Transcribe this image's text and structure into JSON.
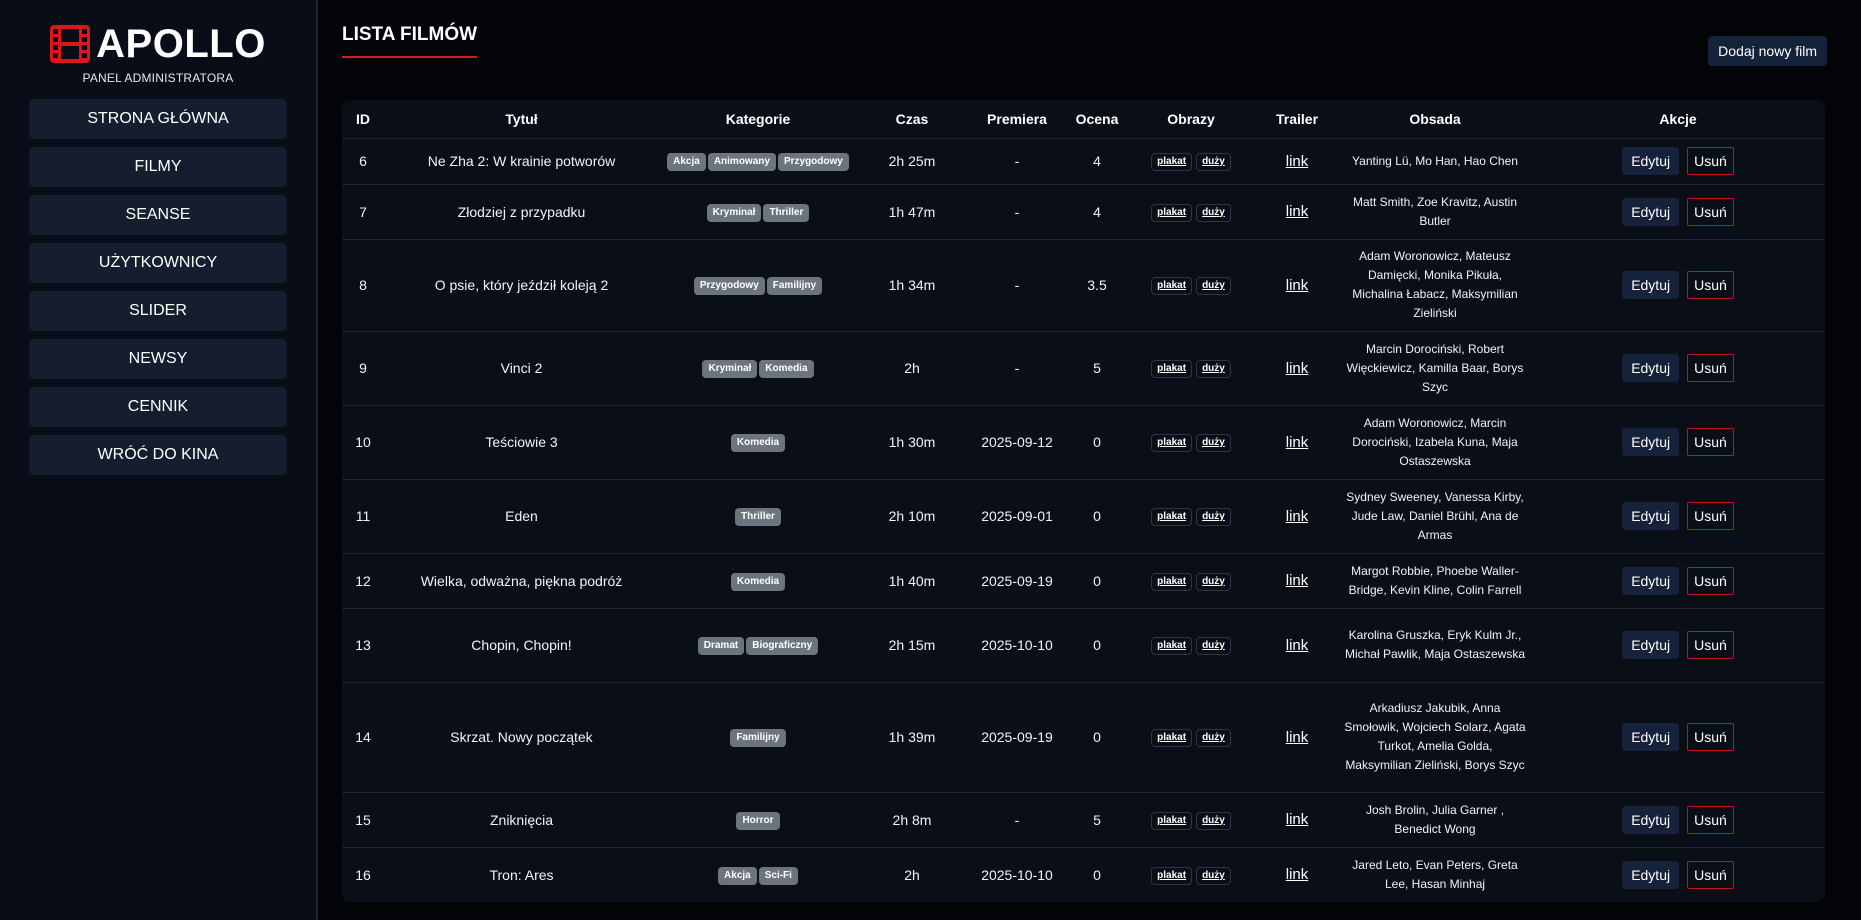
{
  "brand": {
    "name": "APOLLO",
    "subtitle": "PANEL ADMINISTRATORA",
    "logo_icon": "film-reel-icon",
    "logo_color": "#d91818"
  },
  "sidebar": {
    "items": [
      {
        "label": "STRONA GŁÓWNA",
        "key": "home"
      },
      {
        "label": "FILMY",
        "key": "films"
      },
      {
        "label": "SEANSE",
        "key": "screenings"
      },
      {
        "label": "UŻYTKOWNICY",
        "key": "users"
      },
      {
        "label": "SLIDER",
        "key": "slider"
      },
      {
        "label": "NEWSY",
        "key": "news"
      },
      {
        "label": "CENNIK",
        "key": "pricing"
      },
      {
        "label": "WRÓĆ DO KINA",
        "key": "back"
      }
    ]
  },
  "main": {
    "title": "LISTA FILMÓW",
    "add_button": "Dodaj nowy film",
    "columns": [
      "ID",
      "Tytuł",
      "Kategorie",
      "Czas",
      "Premiera",
      "Ocena",
      "Obrazy",
      "Trailer",
      "Obsada",
      "Akcje"
    ],
    "image_labels": {
      "poster": "plakat",
      "large": "duży"
    },
    "trailer_label": "link",
    "edit_label": "Edytuj",
    "delete_label": "Usuń",
    "rows": [
      {
        "id": "6",
        "title": "Ne Zha 2: W krainie potworów",
        "categories": [
          "Akcja",
          "Animowany",
          "Przygodowy"
        ],
        "duration": "2h 25m",
        "premiere": "-",
        "rating": "4",
        "cast": "Yanting Lü, Mo Han, Hao Chen",
        "h": 46
      },
      {
        "id": "7",
        "title": "Złodziej z przypadku",
        "categories": [
          "Kryminał",
          "Thriller"
        ],
        "duration": "1h 47m",
        "premiere": "-",
        "rating": "4",
        "cast": "Matt Smith, Zoe Kravitz, Austin Butler",
        "h": 55
      },
      {
        "id": "8",
        "title": "O psie, który jeździł koleją 2",
        "categories": [
          "Przygodowy",
          "Familijny"
        ],
        "duration": "1h 34m",
        "premiere": "-",
        "rating": "3.5",
        "cast": "Adam Woronowicz, Mateusz Damięcki, Monika Pikuła, Michalina Łabacz, Maksymilian Zieliński",
        "h": 92
      },
      {
        "id": "9",
        "title": "Vinci 2",
        "categories": [
          "Kryminał",
          "Komedia"
        ],
        "duration": "2h",
        "premiere": "-",
        "rating": "5",
        "cast": "Marcin Dorociński, Robert Więckiewicz, Kamilla Baar, Borys Szyc",
        "h": 74
      },
      {
        "id": "10",
        "title": "Teściowie 3",
        "categories": [
          "Komedia"
        ],
        "duration": "1h 30m",
        "premiere": "2025-09-12",
        "rating": "0",
        "cast": "Adam Woronowicz, Marcin Dorociński, Izabela Kuna, Maja Ostaszewska",
        "h": 74
      },
      {
        "id": "11",
        "title": "Eden",
        "categories": [
          "Thriller"
        ],
        "duration": "2h 10m",
        "premiere": "2025-09-01",
        "rating": "0",
        "cast": "Sydney Sweeney, Vanessa Kirby, Jude Law, Daniel Brühl, Ana de Armas",
        "h": 74
      },
      {
        "id": "12",
        "title": "Wielka, odważna, piękna podróż",
        "categories": [
          "Komedia"
        ],
        "duration": "1h 40m",
        "premiere": "2025-09-19",
        "rating": "0",
        "cast": "Margot Robbie, Phoebe Waller-Bridge, Kevin Kline, Colin Farrell",
        "h": 55
      },
      {
        "id": "13",
        "title": "Chopin, Chopin!",
        "categories": [
          "Dramat",
          "Biograficzny"
        ],
        "duration": "2h 15m",
        "premiere": "2025-10-10",
        "rating": "0",
        "cast": "Karolina Gruszka, Eryk Kulm Jr., Michał Pawlik, Maja Ostaszewska",
        "h": 74
      },
      {
        "id": "14",
        "title": "Skrzat. Nowy początek",
        "categories": [
          "Familijny"
        ],
        "duration": "1h 39m",
        "premiere": "2025-09-19",
        "rating": "0",
        "cast": "Arkadiusz Jakubik, Anna Smołowik, Wojciech Solarz, Agata Turkot, Amelia Golda, Maksymilian Zieliński, Borys Szyc",
        "h": 110
      },
      {
        "id": "15",
        "title": "Zniknięcia",
        "categories": [
          "Horror"
        ],
        "duration": "2h 8m",
        "premiere": "-",
        "rating": "5",
        "cast": "Josh Brolin, Julia Garner , Benedict Wong",
        "h": 55
      },
      {
        "id": "16",
        "title": "Tron: Ares",
        "categories": [
          "Akcja",
          "Sci-Fi"
        ],
        "duration": "2h",
        "premiere": "2025-10-10",
        "rating": "0",
        "cast": "Jared Leto, Evan Peters, Greta Lee, Hasan Minhaj",
        "h": 55
      }
    ]
  }
}
